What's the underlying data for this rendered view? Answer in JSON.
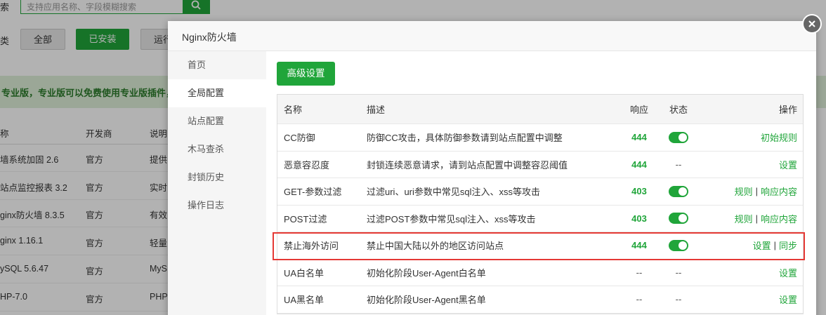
{
  "background": {
    "search_label": "索",
    "search_placeholder": "支持应用名称、字段模糊搜索",
    "category_label": "类",
    "categories": [
      "全部",
      "已安装",
      "运行"
    ],
    "banner": "专业版，专业版可以免费使用专业版插件，过",
    "table_headers": [
      "称",
      "开发商",
      "说明"
    ],
    "rows": [
      {
        "name": "墙系统加固 2.6",
        "dev": "官方",
        "desc": "提供"
      },
      {
        "name": "站点监控报表 3.2",
        "dev": "官方",
        "desc": "实时"
      },
      {
        "name": "ginx防火墙 8.3.5",
        "dev": "官方",
        "desc": "有效"
      },
      {
        "name": "ginx 1.16.1",
        "dev": "官方",
        "desc": "轻量"
      },
      {
        "name": "ySQL 5.6.47",
        "dev": "官方",
        "desc": "MyS"
      },
      {
        "name": "HP-7.0",
        "dev": "官方",
        "desc": "PHP"
      }
    ]
  },
  "modal": {
    "title": "Nginx防火墙",
    "sidebar": [
      "首页",
      "全局配置",
      "站点配置",
      "木马查杀",
      "封锁历史",
      "操作日志"
    ],
    "active_index": 1,
    "advanced_button": "高级设置",
    "table": {
      "headers": {
        "name": "名称",
        "desc": "描述",
        "resp": "响应",
        "status": "状态",
        "ops": "操作"
      },
      "rows": [
        {
          "name": "CC防御",
          "desc": "防御CC攻击，具体防御参数请到站点配置中调整",
          "resp": "444",
          "status": "on",
          "ops": [
            "初始规则"
          ]
        },
        {
          "name": "恶意容忍度",
          "desc": "封锁连续恶意请求，请到站点配置中调整容忍阈值",
          "resp": "444",
          "status": "--",
          "ops": [
            "设置"
          ]
        },
        {
          "name": "GET-参数过滤",
          "desc": "过滤uri、uri参数中常见sql注入、xss等攻击",
          "resp": "403",
          "status": "on",
          "ops": [
            "规则",
            "响应内容"
          ]
        },
        {
          "name": "POST过滤",
          "desc": "过滤POST参数中常见sql注入、xss等攻击",
          "resp": "403",
          "status": "on",
          "ops": [
            "规则",
            "响应内容"
          ]
        },
        {
          "name": "禁止海外访问",
          "desc": "禁止中国大陆以外的地区访问站点",
          "resp": "444",
          "status": "on",
          "ops": [
            "设置",
            "同步"
          ]
        },
        {
          "name": "UA白名单",
          "desc": "初始化阶段User-Agent白名单",
          "resp": "--",
          "status": "--",
          "ops": [
            "设置"
          ]
        },
        {
          "name": "UA黑名单",
          "desc": "初始化阶段User-Agent黑名单",
          "resp": "--",
          "status": "--",
          "ops": [
            "设置"
          ]
        }
      ]
    }
  },
  "colors": {
    "accent": "#20a53a",
    "highlight": "#e53935"
  }
}
